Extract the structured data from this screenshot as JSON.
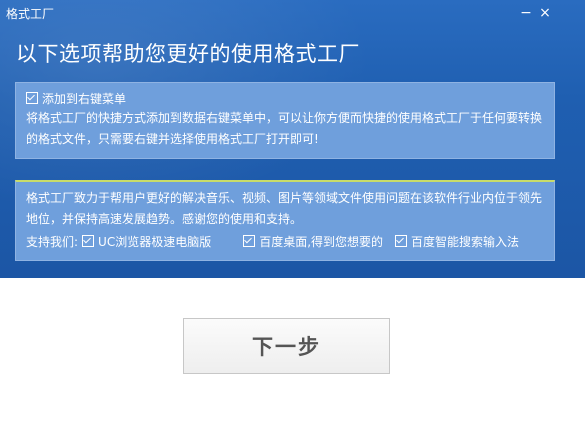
{
  "window": {
    "title": "格式工厂",
    "minimize_glyph": "−",
    "close_glyph": "×"
  },
  "headline": "以下选项帮助您更好的使用格式工厂",
  "panel1": {
    "checkbox_label": "添加到右键菜单",
    "description": "将格式工厂的快捷方式添加到数据右键菜单中，可以让你方便而快捷的使用格式工厂于任何要转换的格式文件，只需要右键并选择使用格式工厂打开即可!"
  },
  "panel2": {
    "description": "格式工厂致力于帮用户更好的解决音乐、视频、图片等领域文件使用问题在该软件行业内位于领先地位，并保持高速发展趋势。感谢您的使用和支持。",
    "support_label": "支持我们:",
    "options": [
      {
        "label": "UC浏览器极速电脑版",
        "checked": true
      },
      {
        "label": "百度桌面,得到您想要的",
        "checked": true
      },
      {
        "label": "百度智能搜索输入法",
        "checked": true
      }
    ]
  },
  "next_button": "下一步",
  "colors": {
    "window_bg": "#1f5fb1",
    "panel_bg": "#6f9fdc",
    "panel_accent": "#c8dc6a",
    "button_text": "#555555"
  }
}
